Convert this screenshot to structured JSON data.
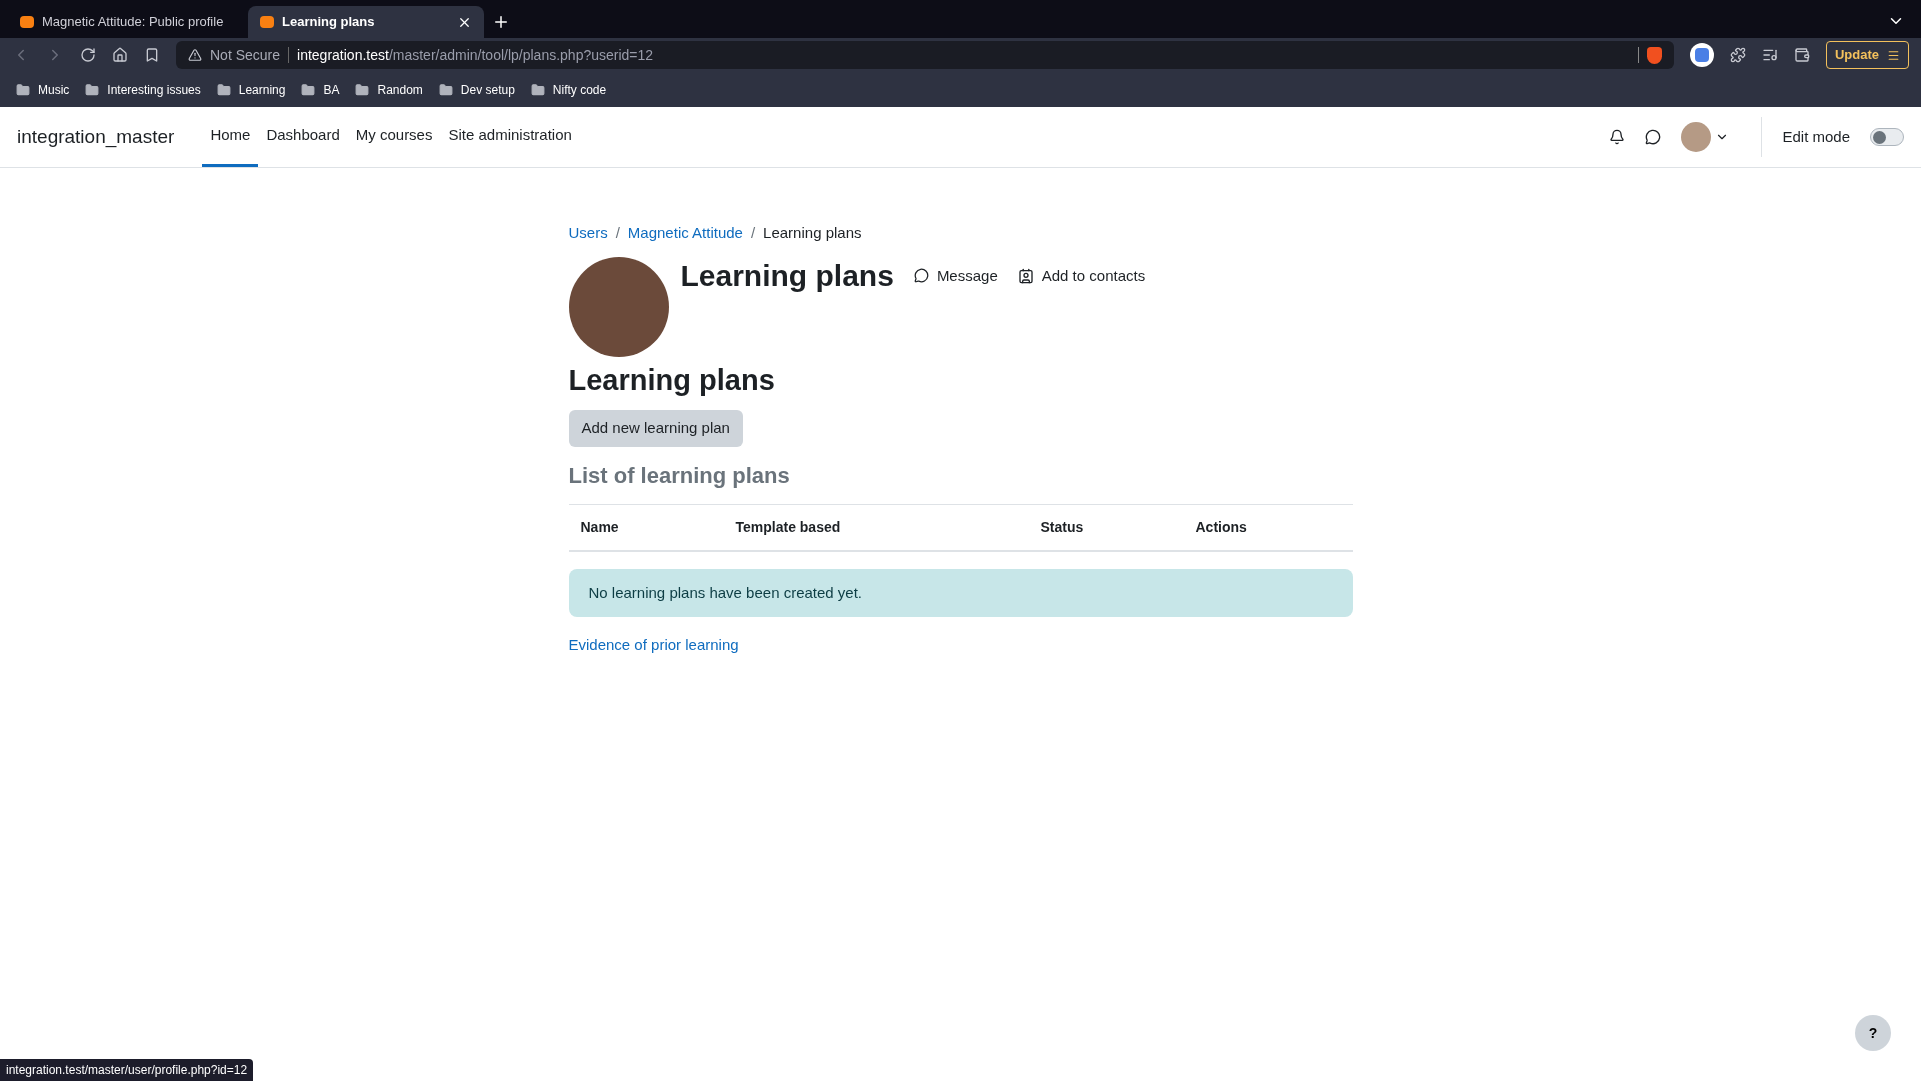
{
  "browser": {
    "tabs": [
      {
        "label": "Magnetic Attitude: Public profile",
        "selected": false
      },
      {
        "label": "Learning plans",
        "selected": true
      }
    ],
    "address": {
      "security": "Not Secure",
      "host": "integration.test",
      "path": "/master/admin/tool/lp/plans.php?userid=12"
    },
    "update_button": "Update",
    "bookmarks": [
      "Music",
      "Interesting issues",
      "Learning",
      "BA",
      "Random",
      "Dev setup",
      "Nifty code"
    ]
  },
  "site": {
    "name": "integration_master",
    "nav": [
      {
        "label": "Home",
        "selected": true
      },
      {
        "label": "Dashboard",
        "selected": false
      },
      {
        "label": "My courses",
        "selected": false
      },
      {
        "label": "Site administration",
        "selected": false
      }
    ],
    "edit_mode": {
      "label": "Edit mode",
      "on": false
    }
  },
  "breadcrumbs": [
    {
      "label": "Users",
      "link": true
    },
    {
      "separator": "/",
      "label": "Magnetic Attitude",
      "link": true
    },
    {
      "separator": "/",
      "label": "Learning plans",
      "link": false
    }
  ],
  "header": {
    "title": "Learning plans",
    "actions": [
      {
        "kind": "message",
        "label": "Message"
      },
      {
        "kind": "contact",
        "label": "Add to contacts"
      }
    ]
  },
  "page_title": "Learning plans",
  "add_button": "Add new learning plan",
  "list_title": "List of learning plans",
  "table": {
    "columns": [
      "Name",
      "Template based",
      "Status",
      "Actions"
    ]
  },
  "notice": "No learning plans have been created yet.",
  "footer_link": "Evidence of prior learning",
  "help_button": "?",
  "status_bar": "integration.test/master/user/profile.php?id=12"
}
